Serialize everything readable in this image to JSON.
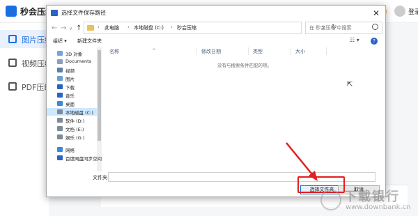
{
  "app": {
    "title": "秒会压缩大师",
    "login": "登录",
    "sidebar": [
      {
        "label": "图片压缩",
        "icon": "image-icon"
      },
      {
        "label": "视频压缩",
        "icon": "video-icon"
      },
      {
        "label": "PDF压缩",
        "icon": "pdf-icon"
      }
    ]
  },
  "dialog": {
    "title": "选择文件保存路径",
    "close": "✕",
    "nav": {
      "back": "←",
      "forward": "→",
      "recent": "∨",
      "up": "↑"
    },
    "breadcrumb": [
      "此电脑",
      "本地磁盘 (C:)",
      "秒会压缩"
    ],
    "breadcrumb_sep": "›",
    "address_dropdown": "∨",
    "refresh": "↻",
    "search_placeholder": "在 秒会压缩 中搜索",
    "toolbar": {
      "organize": "组织 ▾",
      "new_folder": "新建文件夹",
      "view": "☷ ▾",
      "help": "?"
    },
    "tree": [
      {
        "label": "3D 对象",
        "icon": "3d-objects-icon",
        "color": "#6ea6e0"
      },
      {
        "label": "Documents",
        "icon": "documents-icon",
        "color": "#8aa0b8"
      },
      {
        "label": "视频",
        "icon": "videos-icon",
        "color": "#5b7fa8"
      },
      {
        "label": "图片",
        "icon": "pictures-icon",
        "color": "#6a9fd1"
      },
      {
        "label": "下载",
        "icon": "downloads-icon",
        "color": "#2b62c5"
      },
      {
        "label": "音乐",
        "icon": "music-icon",
        "color": "#2b62c5"
      },
      {
        "label": "桌面",
        "icon": "desktop-icon",
        "color": "#3a8ad6"
      },
      {
        "label": "本地磁盘 (C:)",
        "icon": "drive-icon",
        "color": "#7d8a99",
        "selected": true
      },
      {
        "label": "软件 (D:)",
        "icon": "drive-icon",
        "color": "#7d8a99"
      },
      {
        "label": "文档 (E:)",
        "icon": "drive-icon",
        "color": "#7d8a99"
      },
      {
        "label": "娱乐 (G:)",
        "icon": "drive-icon",
        "color": "#7d8a99"
      },
      {
        "label": "网络",
        "icon": "network-icon",
        "color": "#3a8ad6"
      },
      {
        "label": "百度网盘同步空间",
        "icon": "baidu-netdisk-icon",
        "color": "#2b62c5"
      }
    ],
    "columns": [
      "名称",
      "修改日期",
      "类型",
      "大小"
    ],
    "sort_indicator": "^",
    "empty_message": "没有与搜索条件匹配的项。",
    "filename_label": "文件夹:",
    "filename_value": "",
    "buttons": {
      "select": "选择文件夹",
      "cancel": "取消"
    }
  },
  "watermark": {
    "text": "下载银行",
    "url": "www.downbank.cn"
  },
  "colors": {
    "accent": "#1a6fe0",
    "highlight": "#e02020",
    "selection": "#cde8ff"
  }
}
